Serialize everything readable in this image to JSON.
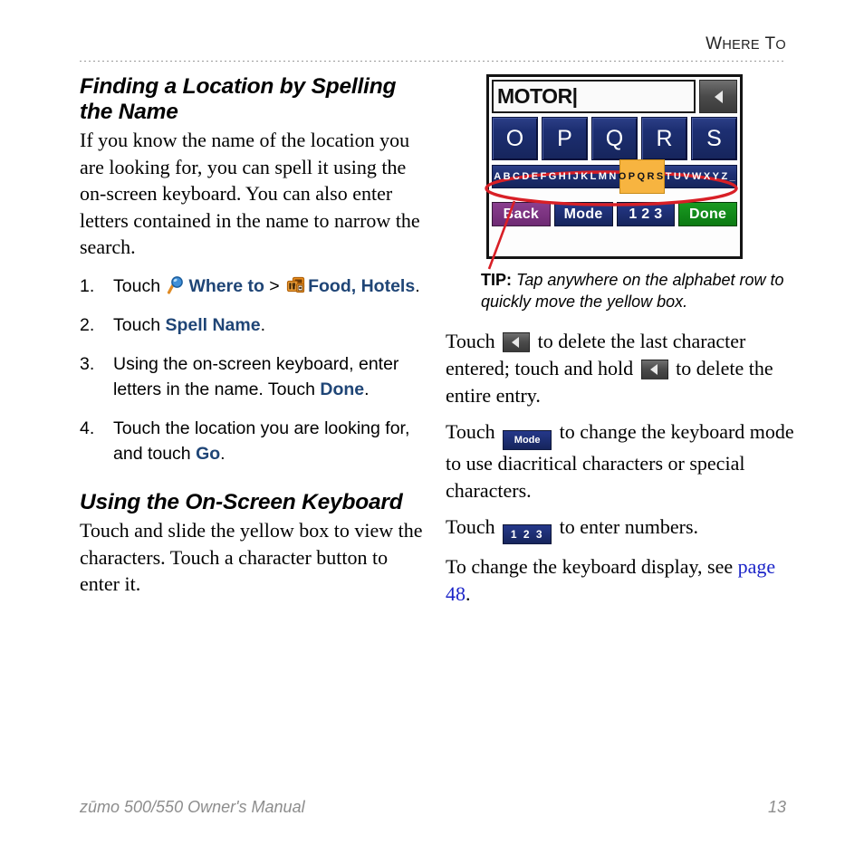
{
  "header": {
    "title_word1_cap": "W",
    "title_word1_rest": "HERE",
    "title_word2_cap": "T",
    "title_word2_rest": "O"
  },
  "left_column": {
    "heading1": "Finding a Location by Spelling the Name",
    "intro": "If you know the name of the location you are looking for, you can spell it using the on-screen keyboard. You can also enter letters contained in the name to narrow the search.",
    "steps": [
      {
        "num": "1.",
        "pre": "Touch ",
        "icon1": "magnifier-icon",
        "ref1": "Where to",
        "mid": " > ",
        "icon2": "food-hotels-icon",
        "ref2": "Food, Hotels",
        "post": "."
      },
      {
        "num": "2.",
        "pre": "Touch ",
        "ref1": "Spell Name",
        "post": "."
      },
      {
        "num": "3.",
        "pre": "Using the on-screen keyboard, enter letters in the name. Touch ",
        "ref1": "Done",
        "post": "."
      },
      {
        "num": "4.",
        "pre": "Touch the location you are looking for, and touch ",
        "ref1": "Go",
        "post": "."
      }
    ],
    "heading2": "Using the On-Screen Keyboard",
    "para2": "Touch and slide the yellow box to view the characters. Touch a character button to enter it."
  },
  "device": {
    "text_field_value": "MOTOR|",
    "backspace_icon": "triangle-left-icon",
    "keys": [
      "O",
      "P",
      "Q",
      "R",
      "S"
    ],
    "alphabet": [
      "A",
      "B",
      "C",
      "D",
      "E",
      "F",
      "G",
      "H",
      "I",
      "J",
      "K",
      "L",
      "M",
      "N",
      "O",
      "P",
      "Q",
      "R",
      "S",
      "T",
      "U",
      "V",
      "W",
      "X",
      "Y",
      "Z",
      "_"
    ],
    "highlight_start_index": 14,
    "highlight_count": 5,
    "buttons": [
      {
        "label": "Back",
        "color": "#7c3382"
      },
      {
        "label": "Mode",
        "color": "#1d2f72"
      },
      {
        "label": "1 2 3",
        "color": "#1d2f72"
      },
      {
        "label": "Done",
        "color": "#12901a"
      }
    ],
    "annotation_color": "#d81f26"
  },
  "tip": {
    "label": "TIP:",
    "text": " Tap anywhere on the alphabet row to quickly move the yellow box."
  },
  "right_column": {
    "para_backspace_1": "Touch ",
    "para_backspace_2": " to delete the last character entered; touch and hold ",
    "para_backspace_3": " to delete the entire entry.",
    "para_mode_1": "Touch ",
    "para_mode_2": " to change the keyboard mode to use diacritical characters or special characters.",
    "para_num_1": "Touch ",
    "para_num_2": " to enter numbers.",
    "para_display_1": "To change the keyboard display, see ",
    "page_link": "page 48",
    "para_display_2": ".",
    "chip_mode_label": "Mode",
    "chip_num_label": "1 2 3"
  },
  "footer": {
    "manual": "zūmo 500/550 Owner's Manual",
    "page_number": "13"
  },
  "colors": {
    "ui_ref_blue": "#1f4576",
    "link_blue": "#1b24c8",
    "annotation_red": "#d81f26",
    "yellow_box": "#f7b440",
    "key_blue": "#1d2f72"
  }
}
